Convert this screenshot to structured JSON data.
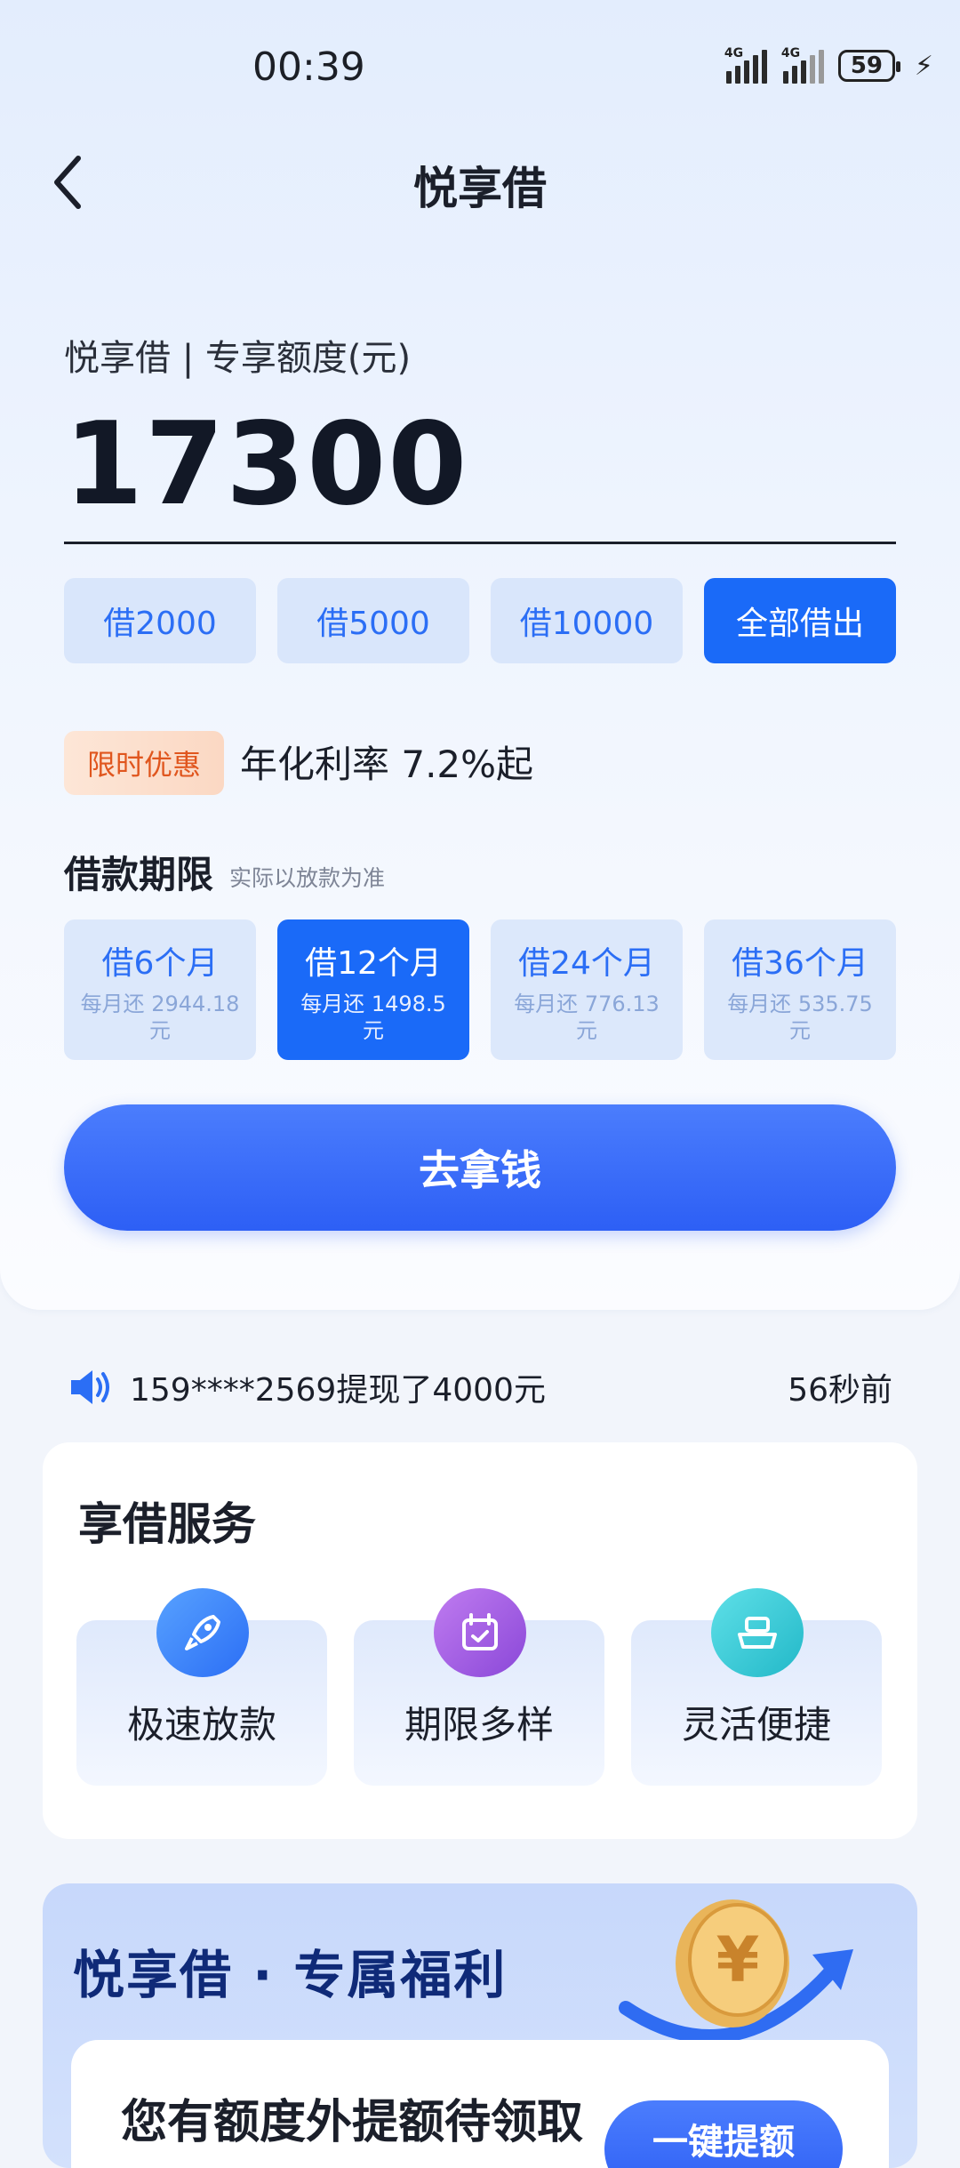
{
  "status_bar": {
    "time": "00:39",
    "signal_label": "4G",
    "battery": "59"
  },
  "nav": {
    "title": "悦享借"
  },
  "quota": {
    "label": "悦享借 | 专享额度(元)",
    "amount": "17300"
  },
  "amount_options": [
    "借2000",
    "借5000",
    "借10000",
    "全部借出"
  ],
  "promo": {
    "badge": "限时优惠",
    "rate_text": "年化利率 7.2%起"
  },
  "term": {
    "title": "借款期限",
    "note": "实际以放款为准",
    "options": [
      {
        "label": "借6个月",
        "sub": "每月还 2944.18元"
      },
      {
        "label": "借12个月",
        "sub": "每月还 1498.5元"
      },
      {
        "label": "借24个月",
        "sub": "每月还 776.13元"
      },
      {
        "label": "借36个月",
        "sub": "每月还 535.75元"
      }
    ]
  },
  "cta": {
    "label": "去拿钱"
  },
  "notice": {
    "text": "159****2569提现了4000元",
    "time": "56秒前"
  },
  "services": {
    "title": "享借服务",
    "items": [
      {
        "label": "极速放款",
        "icon": "rocket-icon"
      },
      {
        "label": "期限多样",
        "icon": "calendar-icon"
      },
      {
        "label": "灵活便捷",
        "icon": "flexible-icon"
      }
    ]
  },
  "benefit": {
    "title": "悦享借 · 专属福利",
    "text": "您有额度外提额待领取",
    "button": "一键提额"
  },
  "colors": {
    "primary": "#1a6af8",
    "promo": "#e0561e",
    "light_blue": "#d9e6fb"
  }
}
